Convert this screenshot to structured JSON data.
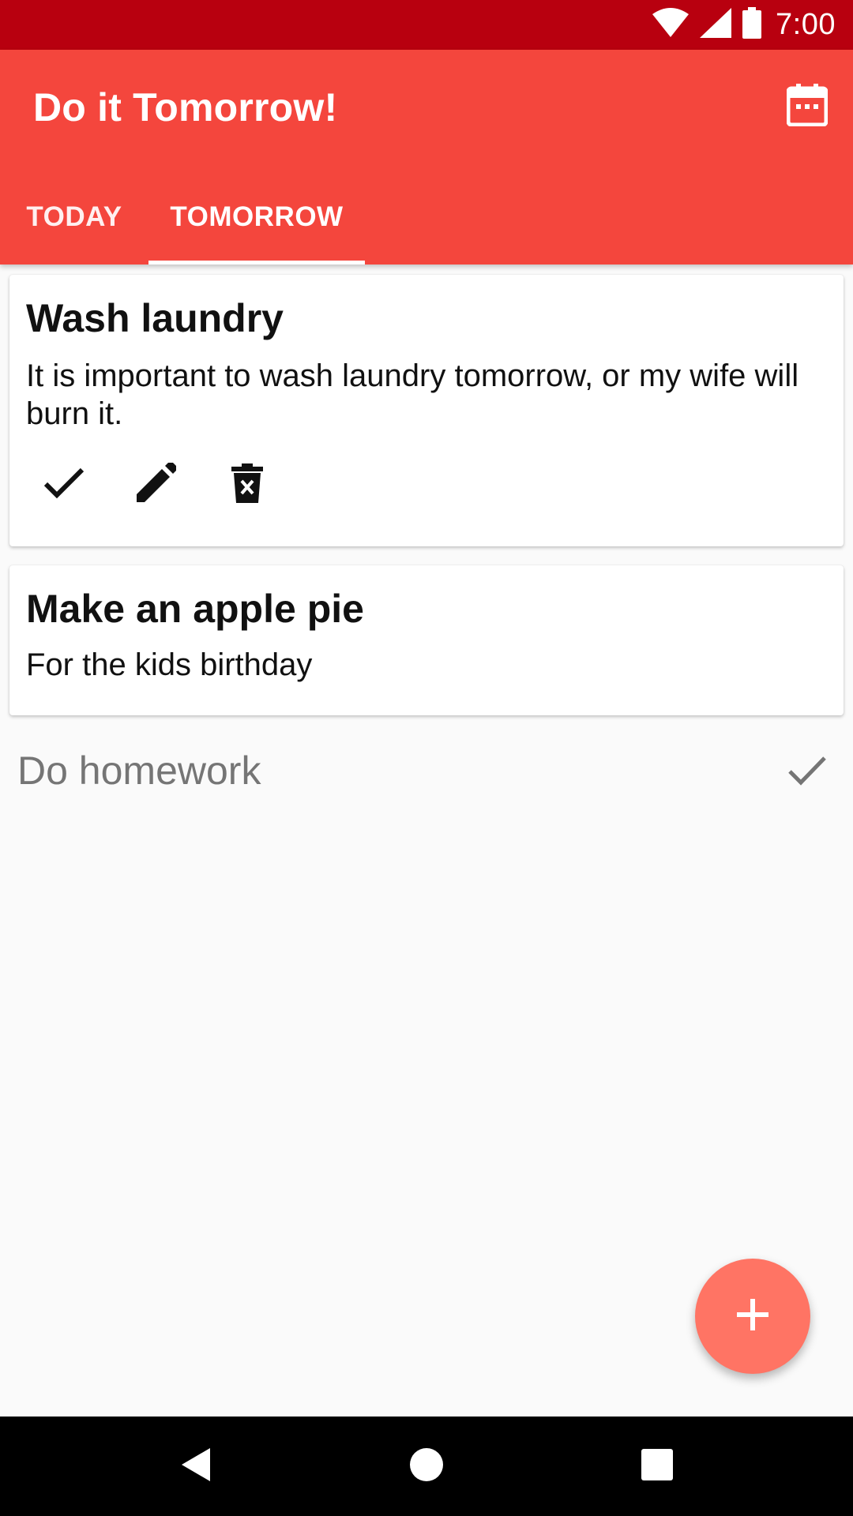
{
  "status_bar": {
    "time": "7:00",
    "icons": [
      "wifi-icon",
      "cellular-signal-icon",
      "battery-icon"
    ]
  },
  "app_bar": {
    "title": "Do it Tomorrow!",
    "action_icon": "calendar-icon",
    "color": "#f4463d",
    "status_color": "#b8000f"
  },
  "tabs": [
    {
      "label": "TODAY",
      "selected": false
    },
    {
      "label": "TOMORROW",
      "selected": true
    }
  ],
  "tasks": [
    {
      "title": "Wash laundry",
      "description": "It is important to wash laundry tomorrow, or my wife will burn it.",
      "expanded": true,
      "actions": [
        "check-icon",
        "edit-pencil-icon",
        "delete-icon"
      ]
    },
    {
      "title": "Make an apple pie",
      "description": "For the kids birthday",
      "expanded": false
    }
  ],
  "done_tasks": [
    {
      "title": "Do homework",
      "icon": "check-icon"
    }
  ],
  "fab": {
    "icon": "plus-icon",
    "color": "#ff7464"
  },
  "nav_bar": {
    "buttons": [
      "back-icon",
      "home-icon",
      "recents-icon"
    ]
  }
}
